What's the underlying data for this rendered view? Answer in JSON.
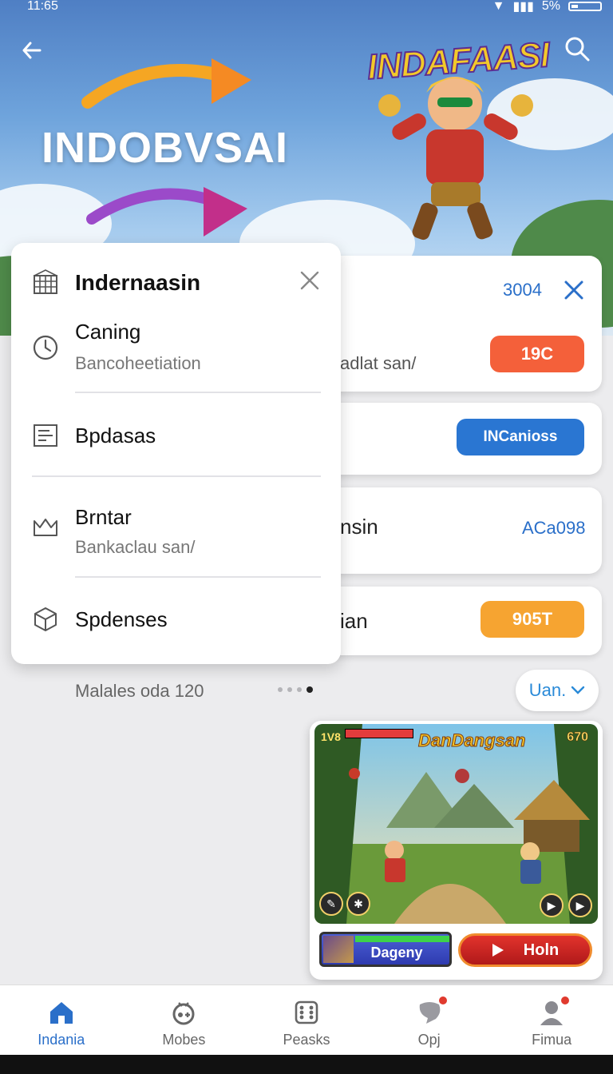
{
  "status_bar": {
    "time": "11:65",
    "battery": "5%"
  },
  "hero": {
    "title": "INDOBVSAI",
    "logo_text": "INDAFAASI"
  },
  "menu": {
    "title": "Indernaasin",
    "items": [
      {
        "label": "Caning",
        "sub": "Bancoheetiation"
      },
      {
        "label": "Bpdasas",
        "sub": ""
      },
      {
        "label": "Brntar",
        "sub": "Bankaclau san/"
      },
      {
        "label": "Spdenses",
        "sub": ""
      }
    ]
  },
  "cards": {
    "card1": {
      "value": "3004",
      "sub": "adlat san/",
      "pill": "19C",
      "pill_color": "#f4603a"
    },
    "card2": {
      "pill": "INCanioss",
      "pill_color": "#2a76d2"
    },
    "card3": {
      "text": "nsin",
      "value": "ACa098"
    },
    "card4": {
      "text": "ian",
      "pill": "905T",
      "pill_color": "#f6a431"
    }
  },
  "footer": {
    "matches": "Malales oda 120",
    "view_label": "Uan."
  },
  "game": {
    "title": "DanDangsan",
    "level": "1V8",
    "score": "670",
    "sub_button": "Dageny",
    "play_button": "Holn"
  },
  "nav": [
    {
      "label": "Indania",
      "icon": "home-icon"
    },
    {
      "label": "Mobes",
      "icon": "controller-icon"
    },
    {
      "label": "Peasks",
      "icon": "dice-icon"
    },
    {
      "label": "Opj",
      "icon": "chat-icon"
    },
    {
      "label": "Fimua",
      "icon": "profile-icon"
    }
  ]
}
